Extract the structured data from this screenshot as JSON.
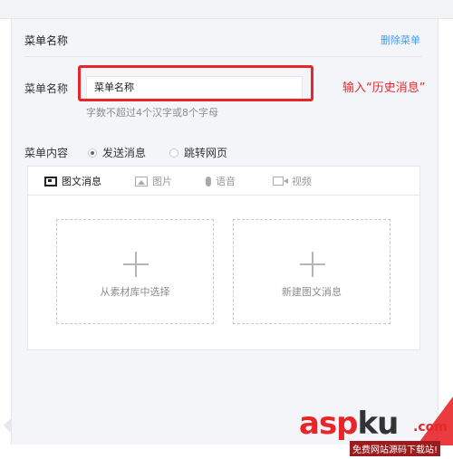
{
  "menu": {
    "section_title": "菜单名称",
    "delete_link": "删除菜单",
    "name_label": "菜单名称",
    "name_value": "菜单名称",
    "hint": "字数不超过4个汉字或8个字母",
    "annotation": "输入“历史消息”",
    "content_label": "菜单内容",
    "options": [
      {
        "label": "发送消息",
        "selected": true
      },
      {
        "label": "跳转网页",
        "selected": false
      }
    ]
  },
  "editor": {
    "tabs": [
      {
        "label": "图文消息",
        "icon": "news-icon",
        "active": true
      },
      {
        "label": "图片",
        "icon": "image-icon",
        "active": false
      },
      {
        "label": "语音",
        "icon": "voice-icon",
        "active": false
      },
      {
        "label": "视频",
        "icon": "video-icon",
        "active": false
      }
    ],
    "cards": [
      {
        "label": "从素材库中选择"
      },
      {
        "label": "新建图文消息"
      }
    ]
  },
  "watermark": {
    "brand_left": "asp",
    "brand_right": "ku",
    "tld": ".com",
    "tagline": "免费网站源码下载站!"
  },
  "colors": {
    "accent_link": "#459ae9",
    "annotation_red": "#e8262a"
  }
}
